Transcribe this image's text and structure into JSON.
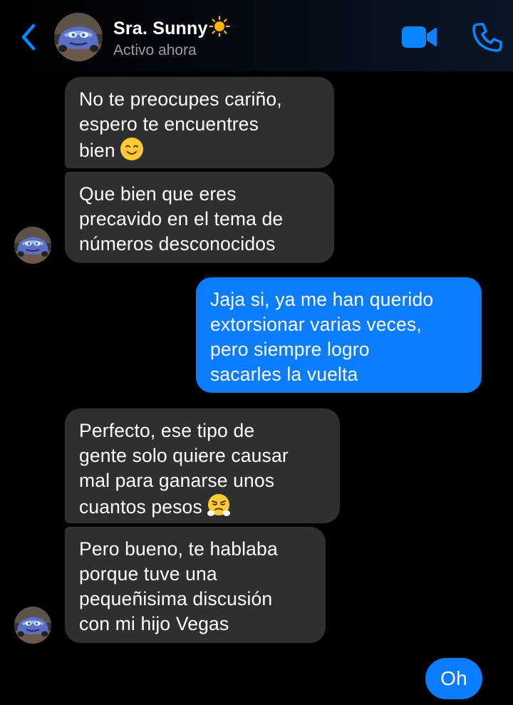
{
  "header": {
    "contact_name": "Sra. Sunny",
    "status": "Activo ahora",
    "icons": {
      "back": "chevron-left-icon",
      "video": "video-camera-icon",
      "call": "phone-icon",
      "name_suffix": "sun-icon"
    }
  },
  "colors": {
    "accent": "#0a7cff",
    "incoming_bubble": "#2f2f2f",
    "background": "#000000"
  },
  "messages": [
    {
      "direction": "incoming",
      "lines": [
        "No te preocupes cariño,",
        "espero te encuentres",
        "bien"
      ],
      "trailing_emoji": "smiling-face-emoji"
    },
    {
      "direction": "incoming",
      "lines": [
        "Que bien que eres",
        "precavido en el tema de",
        "números desconocidos"
      ]
    },
    {
      "direction": "outgoing",
      "lines": [
        "Jaja si, ya me han querido",
        "extorsionar varias veces,",
        "pero siempre logro",
        "sacarles la vuelta"
      ]
    },
    {
      "direction": "incoming",
      "lines": [
        "Perfecto, ese tipo de",
        "gente solo quiere causar",
        "mal para ganarse unos",
        "cuantos pesos"
      ],
      "trailing_emoji": "face-with-steam-emoji"
    },
    {
      "direction": "incoming",
      "lines": [
        "Pero bueno, te hablaba",
        "porque tuve una",
        "pequeñisima discusión",
        "con mi hijo Vegas"
      ]
    },
    {
      "direction": "outgoing",
      "lines": [
        "Oh"
      ]
    }
  ]
}
